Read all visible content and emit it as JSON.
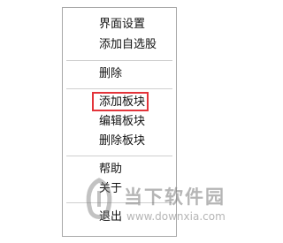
{
  "context_menu": {
    "items": [
      {
        "label": "界面设置"
      },
      {
        "label": "添加自选股"
      },
      {
        "label": "删除"
      },
      {
        "label": "添加板块"
      },
      {
        "label": "编辑板块"
      },
      {
        "label": "删除板块"
      },
      {
        "label": "帮助"
      },
      {
        "label": "关于"
      },
      {
        "label": "退出"
      }
    ],
    "highlighted_item": "添加板块",
    "highlight_color": "#e3343a"
  },
  "watermark": {
    "title": "当下软件园",
    "url": "www.downxia.com"
  }
}
